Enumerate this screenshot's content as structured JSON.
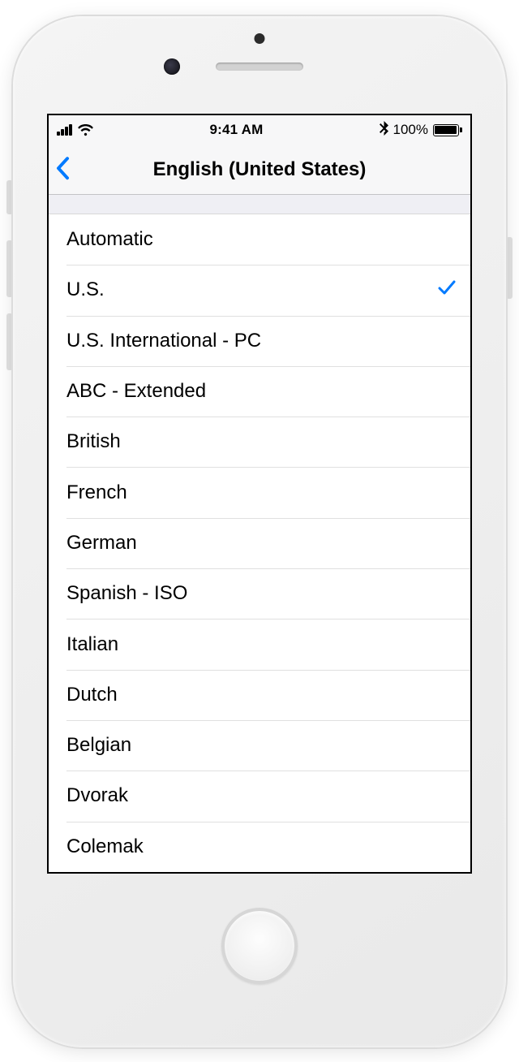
{
  "status": {
    "time": "9:41 AM",
    "battery_pct": "100%"
  },
  "nav": {
    "title": "English (United States)"
  },
  "layouts": [
    {
      "label": "Automatic",
      "selected": false
    },
    {
      "label": "U.S.",
      "selected": true
    },
    {
      "label": "U.S. International - PC",
      "selected": false
    },
    {
      "label": "ABC - Extended",
      "selected": false
    },
    {
      "label": "British",
      "selected": false
    },
    {
      "label": "French",
      "selected": false
    },
    {
      "label": "German",
      "selected": false
    },
    {
      "label": "Spanish - ISO",
      "selected": false
    },
    {
      "label": "Italian",
      "selected": false
    },
    {
      "label": "Dutch",
      "selected": false
    },
    {
      "label": "Belgian",
      "selected": false
    },
    {
      "label": "Dvorak",
      "selected": false
    },
    {
      "label": "Colemak",
      "selected": false
    }
  ]
}
